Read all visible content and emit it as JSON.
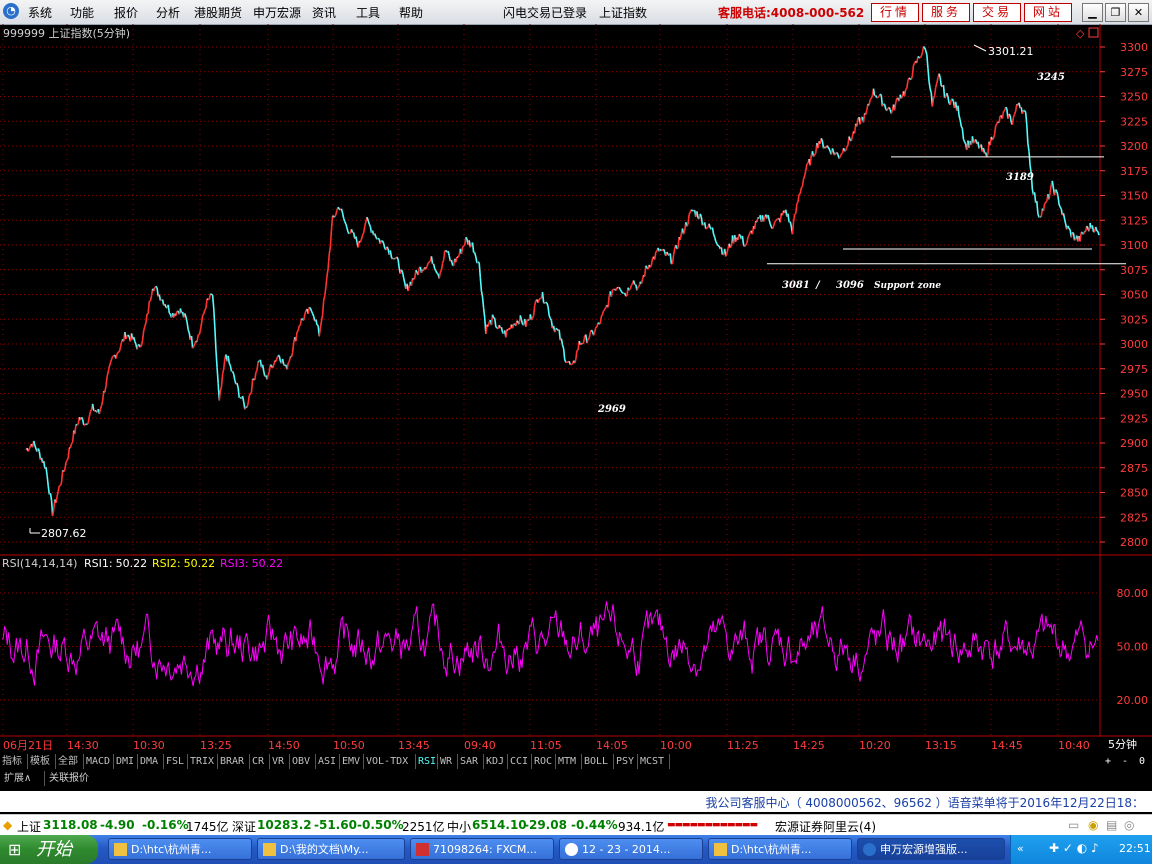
{
  "menu": {
    "items": [
      "系统",
      "功能",
      "报价",
      "分析",
      "港股期货",
      "申万宏源",
      "资讯",
      "工具",
      "帮助"
    ],
    "status": "闪电交易已登录",
    "index_name": "上证指数",
    "hotline": "客服电话:4008-000-562",
    "service_buttons": [
      "行情",
      "服务",
      "交易",
      "网站"
    ]
  },
  "colors": {
    "up": "#ff3232",
    "down": "#54fcfc",
    "rsi": "#ff00ff",
    "grid": "#8b0000",
    "axis": "#ff3c3c",
    "menu_red": "#cc0000"
  },
  "chart_data": [
    {
      "type": "line",
      "title": "999999 上证指数(5分钟)",
      "series": [
        {
          "values": [
            2893,
            2900,
            2890,
            2875,
            2830,
            2855,
            2880,
            2905,
            2925,
            2920,
            2935,
            2930,
            2960,
            2985,
            2995,
            3010,
            3005,
            2995,
            3020,
            3060,
            3050,
            3040,
            3030,
            3035,
            3025,
            3000,
            3010,
            3040,
            3050,
            2940,
            2990,
            2970,
            2950,
            2935,
            2960,
            2985,
            2965,
            2980,
            2990,
            2975,
            2995,
            3020,
            3030,
            3035,
            3010,
            3055,
            3125,
            3140,
            3120,
            3110,
            3100,
            3125,
            3115,
            3105,
            3100,
            3090,
            3080,
            3055,
            3065,
            3075,
            3080,
            3085,
            3070,
            3095,
            3080,
            3090,
            3105,
            3100,
            3080,
            3015,
            3025,
            3015,
            3010,
            3020,
            3025,
            3020,
            3030,
            3050,
            3045,
            3020,
            3010,
            2985,
            2975,
            3000,
            3005,
            3010,
            3020,
            3035,
            3055,
            3060,
            3050,
            3065,
            3055,
            3075,
            3085,
            3095,
            3090,
            3085,
            3105,
            3120,
            3135,
            3130,
            3120,
            3115,
            3100,
            3090,
            3105,
            3110,
            3100,
            3115,
            3125,
            3130,
            3120,
            3125,
            3135,
            3115,
            3150,
            3175,
            3190,
            3205,
            3200,
            3195,
            3190,
            3200,
            3210,
            3225,
            3230,
            3255,
            3250,
            3240,
            3235,
            3250,
            3255,
            3275,
            3290,
            3300,
            3240,
            3270,
            3250,
            3245,
            3235,
            3200,
            3205,
            3200,
            3190,
            3210,
            3225,
            3235,
            3225,
            3245,
            3230,
            3160,
            3130,
            3140,
            3160,
            3145,
            3120,
            3110,
            3105,
            3115,
            3120,
            3110
          ]
        }
      ],
      "ylim": [
        2790,
        3310
      ],
      "y_ticks": [
        "3300",
        "3275",
        "3250",
        "3225",
        "3200",
        "3175",
        "3150",
        "3125",
        "3100",
        "3075",
        "3050",
        "3025",
        "3000",
        "2975",
        "2950",
        "2925",
        "2900",
        "2875",
        "2850",
        "2825",
        "2800"
      ],
      "annotations": {
        "max_label": "3301.21",
        "min_label": "2807.62",
        "a3245": "3245",
        "a3189": "3189",
        "a2969": "2969",
        "s3081": "3081",
        "slash": "/",
        "s3096": "3096",
        "support": "Support zone"
      },
      "support_levels": [
        3189,
        3096,
        3081
      ]
    },
    {
      "type": "line",
      "title": "RSI(14,14,14)",
      "legend": [
        {
          "name": "RSI1:",
          "value": "50.22",
          "color": "#ffffff"
        },
        {
          "name": "RSI2:",
          "value": "50.22",
          "color": "#ffff00"
        },
        {
          "name": "RSI3:",
          "value": "50.22",
          "color": "#ff00ff"
        }
      ],
      "ylim": [
        0,
        100
      ],
      "y_ticks": [
        "80.00",
        "50.00",
        "20.00"
      ],
      "x_ticks": [
        "06月21日",
        "14:30",
        "10:30",
        "13:25",
        "14:50",
        "10:50",
        "13:45",
        "09:40",
        "11:05",
        "14:05",
        "10:00",
        "11:25",
        "14:25",
        "10:20",
        "13:15",
        "14:45",
        "10:40"
      ],
      "period": "5分钟"
    }
  ],
  "indicator_tabs": [
    "指标",
    "模板",
    "全部",
    "MACD",
    "DMI",
    "DMA",
    "FSL",
    "TRIX",
    "BRAR",
    "CR",
    "VR",
    "OBV",
    "ASI",
    "EMV",
    "VOL-TDX",
    "RSI",
    "WR",
    "SAR",
    "KDJ",
    "CCI",
    "ROC",
    "MTM",
    "BOLL",
    "PSY",
    "MCST"
  ],
  "active_tab": "RSI",
  "tab_controls": [
    "+",
    "-",
    "0"
  ],
  "sub_tabs": [
    "扩展∧",
    "关联报价"
  ],
  "notice": "我公司客服中心（ 4008000562、96562 ）语音菜单将于2016年12月22日18：",
  "ticker": {
    "sh_name": "上证",
    "sh_value": "3118.08",
    "sh_change": "-4.90",
    "sh_pct": "-0.16%",
    "sh_amount": "1745亿",
    "sz_name": "深证",
    "sz_value": "10283.2",
    "sz_change": "-51.60",
    "sz_pct": "-0.50%",
    "sz_amount": "2251亿",
    "zx_name": "中小",
    "zx_value": "6514.10",
    "zx_change": "-29.08",
    "zx_pct": "-0.44%",
    "zx_amount": "934.1亿",
    "broker": "宏源证券阿里云(4)"
  },
  "taskbar": {
    "start": "开始",
    "tasks": [
      "D:\\htc\\杭州青...",
      "D:\\我的文档\\My...",
      "71098264: FXCM...",
      "12 - 23 - 2014...",
      "D:\\htc\\杭州青...",
      "申万宏源增强版..."
    ],
    "clock": "22:51"
  }
}
